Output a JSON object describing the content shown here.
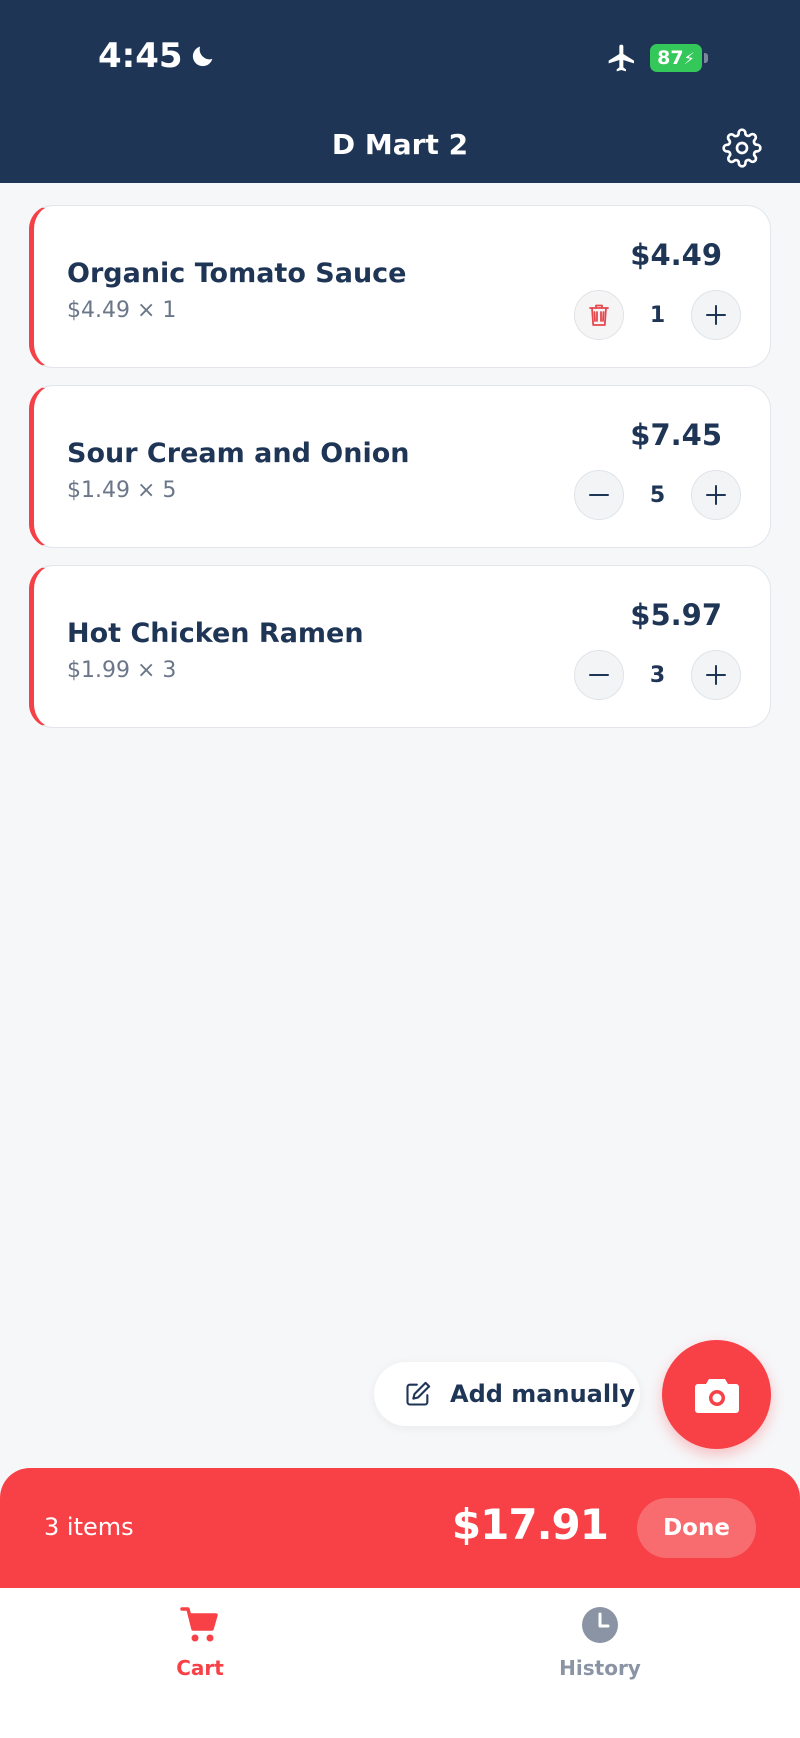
{
  "status_bar": {
    "time": "4:45",
    "battery": "87"
  },
  "header": {
    "title": "D Mart 2"
  },
  "cart_items": [
    {
      "name": "Organic Tomato Sauce",
      "unit_line": "$4.49 × 1",
      "total": "$4.49",
      "qty": "1",
      "decrement": "trash"
    },
    {
      "name": "Sour Cream and Onion",
      "unit_line": "$1.49 × 5",
      "total": "$7.45",
      "qty": "5",
      "decrement": "minus"
    },
    {
      "name": "Hot Chicken Ramen",
      "unit_line": "$1.99 × 3",
      "total": "$5.97",
      "qty": "3",
      "decrement": "minus"
    }
  ],
  "actions": {
    "add_manually": "Add manually"
  },
  "summary": {
    "items_count": "3 items",
    "total": "$17.91",
    "done": "Done"
  },
  "tabs": [
    {
      "label": "Cart",
      "icon": "cart-icon",
      "active": true
    },
    {
      "label": "History",
      "icon": "clock-icon",
      "active": false
    }
  ],
  "colors": {
    "navy": "#1e3556",
    "accent": "#f74147",
    "battery": "#34c759"
  }
}
